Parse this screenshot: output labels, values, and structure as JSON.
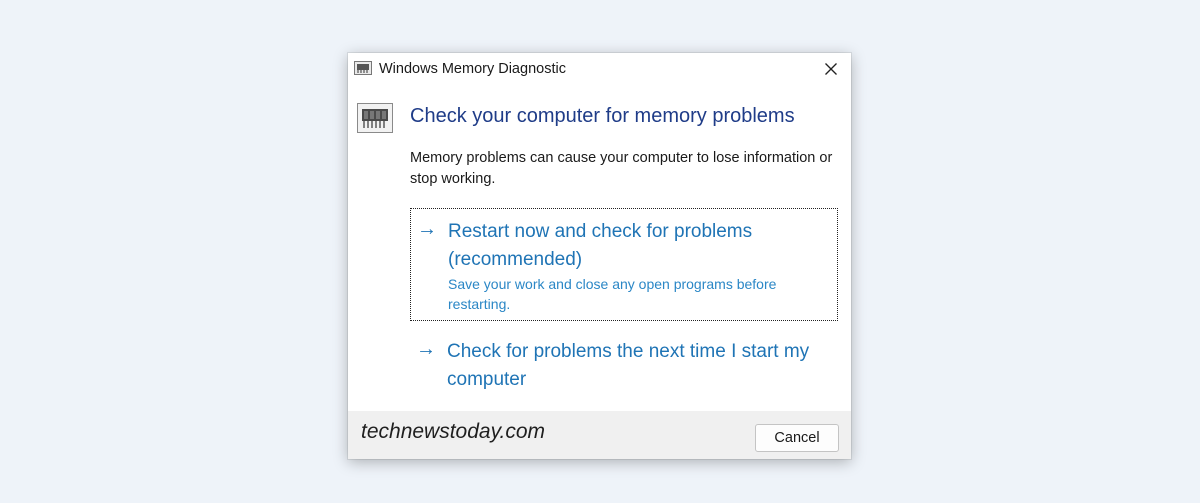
{
  "window": {
    "title": "Windows Memory Diagnostic",
    "icon": "memory-chip-icon",
    "close_icon": "close-icon"
  },
  "main": {
    "icon": "memory-chip-icon",
    "heading": "Check your computer for memory problems",
    "description": "Memory problems can cause your computer to lose information or stop working."
  },
  "options": [
    {
      "arrow": "→",
      "title": "Restart now and check for problems (recommended)",
      "subtitle": "Save your work and close any open programs before restarting."
    },
    {
      "arrow": "→",
      "title": "Check for problems the next time I start my computer"
    }
  ],
  "footer": {
    "watermark": "technewstoday.com",
    "cancel_label": "Cancel"
  },
  "colors": {
    "heading": "#1f3c88",
    "link": "#1f74b5",
    "background": "#eef3f9"
  }
}
